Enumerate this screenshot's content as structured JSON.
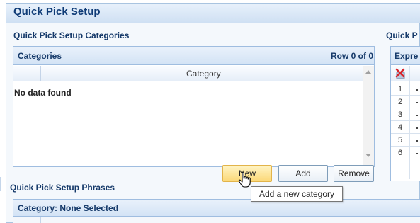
{
  "window": {
    "title": "Quick Pick Setup"
  },
  "categories_section": {
    "label": "Quick Pick Setup Categories",
    "panel_title": "Categories",
    "row_count": "Row 0 of 0",
    "column_header": "Category",
    "empty_text": "No data found"
  },
  "buttons": {
    "new": "New",
    "add": "Add",
    "remove": "Remove"
  },
  "tooltip": "Add a new category",
  "phrases_section": {
    "label": "Quick Pick Setup Phrases",
    "panel_title": "Category: None Selected"
  },
  "right_section": {
    "label": "Quick P",
    "panel_title": "Expre",
    "rows": [
      "1",
      "2",
      "3",
      "4",
      "5",
      "6"
    ]
  },
  "colors": {
    "header_text": "#0f3b76",
    "border": "#9fbde0",
    "highlight_button": "#fbd878"
  },
  "icons": [
    "hand-cursor-icon",
    "delete-x-icon",
    "scroll-up-arrow-icon",
    "scroll-down-arrow-icon"
  ]
}
